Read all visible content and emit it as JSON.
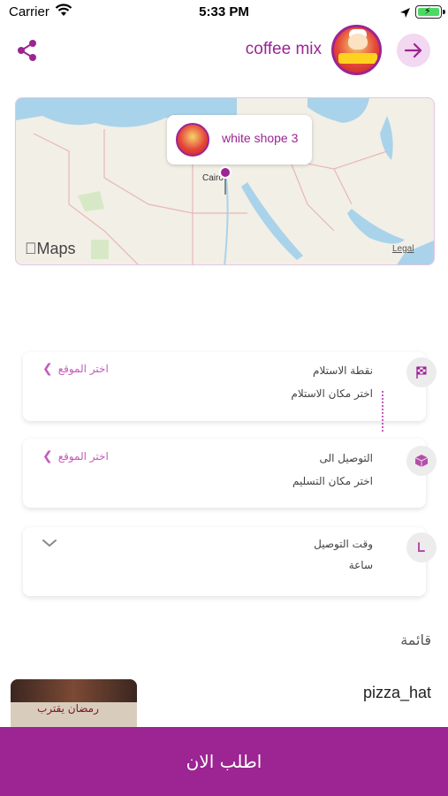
{
  "status_bar": {
    "carrier": "Carrier",
    "time": "5:33 PM"
  },
  "header": {
    "store_name": "coffee mix"
  },
  "map": {
    "callout_label": "white shope 3",
    "city_label": "Cairo",
    "brand": "Maps",
    "legal": "Legal"
  },
  "pickup": {
    "title": "نقطة الاستلام",
    "value": "اختر مكان الاستلام",
    "action": "اختر الموقع"
  },
  "delivery": {
    "title": "التوصيل الى",
    "value": "اختر مكان التسليم",
    "action": "اختر الموقع"
  },
  "delivery_time": {
    "title": "وقت التوصيل",
    "value": "ساعة"
  },
  "list": {
    "title": "قائمة",
    "items": [
      {
        "name": "pizza_hat",
        "thumb_text": "رمضان يقترب"
      }
    ]
  },
  "order_button": {
    "label": "اطلب الان"
  },
  "colors": {
    "accent": "#9c2493",
    "accent_light": "#f2d8f0",
    "action_text": "#c45ab9"
  }
}
